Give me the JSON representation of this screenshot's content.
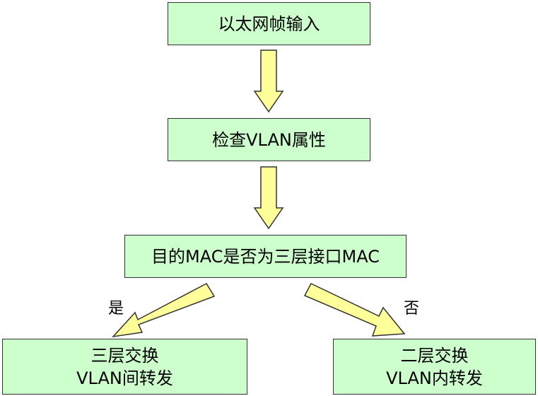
{
  "nodes": {
    "input": "以太网帧输入",
    "check_vlan": "检查VLAN属性",
    "decision": "目的MAC是否为三层接口MAC",
    "l3": {
      "line1": "三层交换",
      "line2": "VLAN间转发"
    },
    "l2": {
      "line1": "二层交换",
      "line2": "VLAN内转发"
    }
  },
  "edges": {
    "yes_label": "是",
    "no_label": "否"
  },
  "colors": {
    "box_fill": "#ccffcc",
    "arrow_fill": "#ffff99",
    "border": "#333333"
  }
}
